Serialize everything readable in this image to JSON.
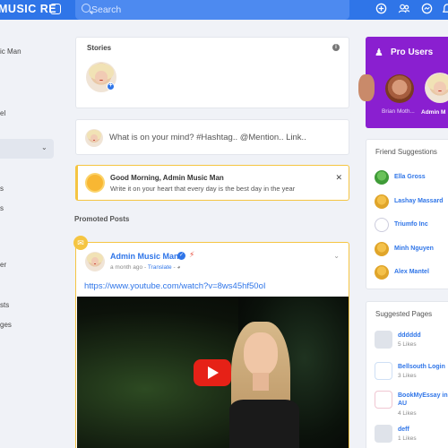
{
  "header": {
    "brand": "MUSIC RE",
    "search_placeholder": "Search"
  },
  "left_sidebar": {
    "items": [
      "ic Man",
      "el",
      "s",
      "s",
      "er",
      "sts",
      "ges"
    ]
  },
  "stories": {
    "title": "Stories"
  },
  "composer": {
    "placeholder": "What is on your mind? #Hashtag.. @Mention.. Link.."
  },
  "greeting": {
    "title": "Good Morning, Admin Music Man",
    "subtitle": "Write it on your heart that every day is the best day in the year"
  },
  "promoted": {
    "label": "Promoted Posts",
    "author": "Admin Music Man",
    "time": "a month ago",
    "translate": "Translate",
    "link": "https://www.youtube.com/watch?v=8ws45hf50oI"
  },
  "pro_users": {
    "title": "Pro Users",
    "names": [
      "Brian Moth...",
      "Admin M"
    ]
  },
  "friend_suggestions": {
    "title": "Friend Suggestions",
    "items": [
      "Ella Gross",
      "Lashay Massard",
      "Triumfo Inc",
      "Minh Nguyen",
      "Alex Mantel"
    ]
  },
  "suggested_pages": {
    "title": "Suggested Pages",
    "items": [
      {
        "name": "dddddd",
        "likes": "5 Likes"
      },
      {
        "name": "Bellsouth Login",
        "likes": "3 Likes"
      },
      {
        "name": "BookMyEssay in AU",
        "likes": "4 Likes"
      },
      {
        "name": "deff",
        "likes": "1 Likes"
      }
    ]
  },
  "colors": {
    "primary": "#2f75e8",
    "pro_purple": "#8a1fd0",
    "promo_yellow": "#f5c542"
  }
}
